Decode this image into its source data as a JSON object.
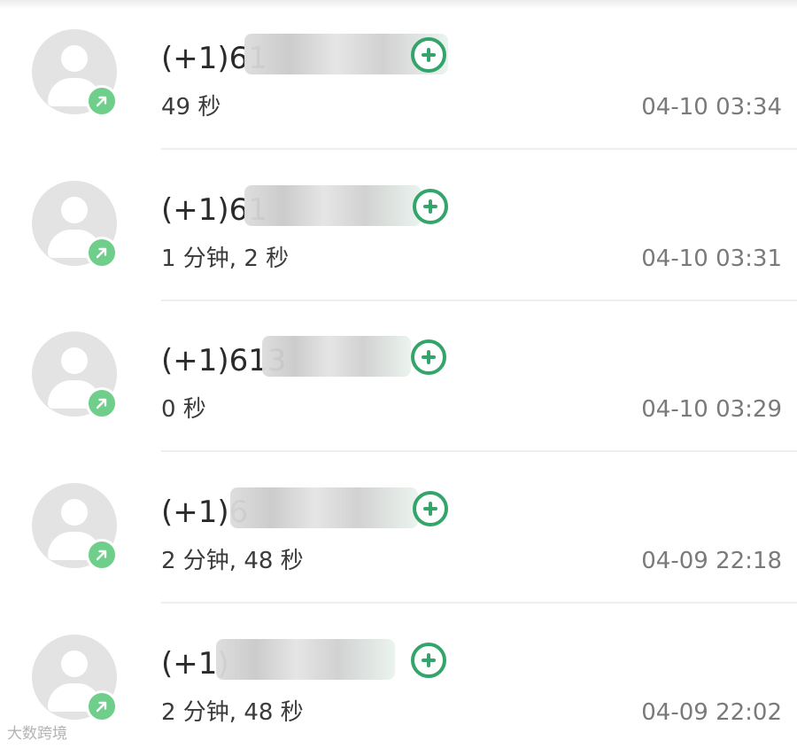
{
  "call_log": {
    "entries": [
      {
        "number": "(+1)61",
        "duration": "49 秒",
        "time": "04-10 03:34"
      },
      {
        "number": "(+1)61",
        "duration": "1 分钟, 2 秒",
        "time": "04-10 03:31"
      },
      {
        "number": "(+1)613",
        "duration": "0 秒",
        "time": "04-10 03:29"
      },
      {
        "number": "(+1)6",
        "duration": "2 分钟, 48 秒",
        "time": "04-09 22:18"
      },
      {
        "number": "(+1)",
        "duration": "2 分钟, 48 秒",
        "time": "04-09 22:02"
      }
    ]
  },
  "icons": {
    "avatar": "person-icon",
    "call_type": "outgoing-call-arrow-icon",
    "add": "add-contact-plus-icon"
  },
  "colors": {
    "accent_green": "#34a56a",
    "badge_green": "#6fcf8a",
    "avatar_gray": "#e3e3e3"
  },
  "watermark": {
    "text": "大数跨境"
  }
}
